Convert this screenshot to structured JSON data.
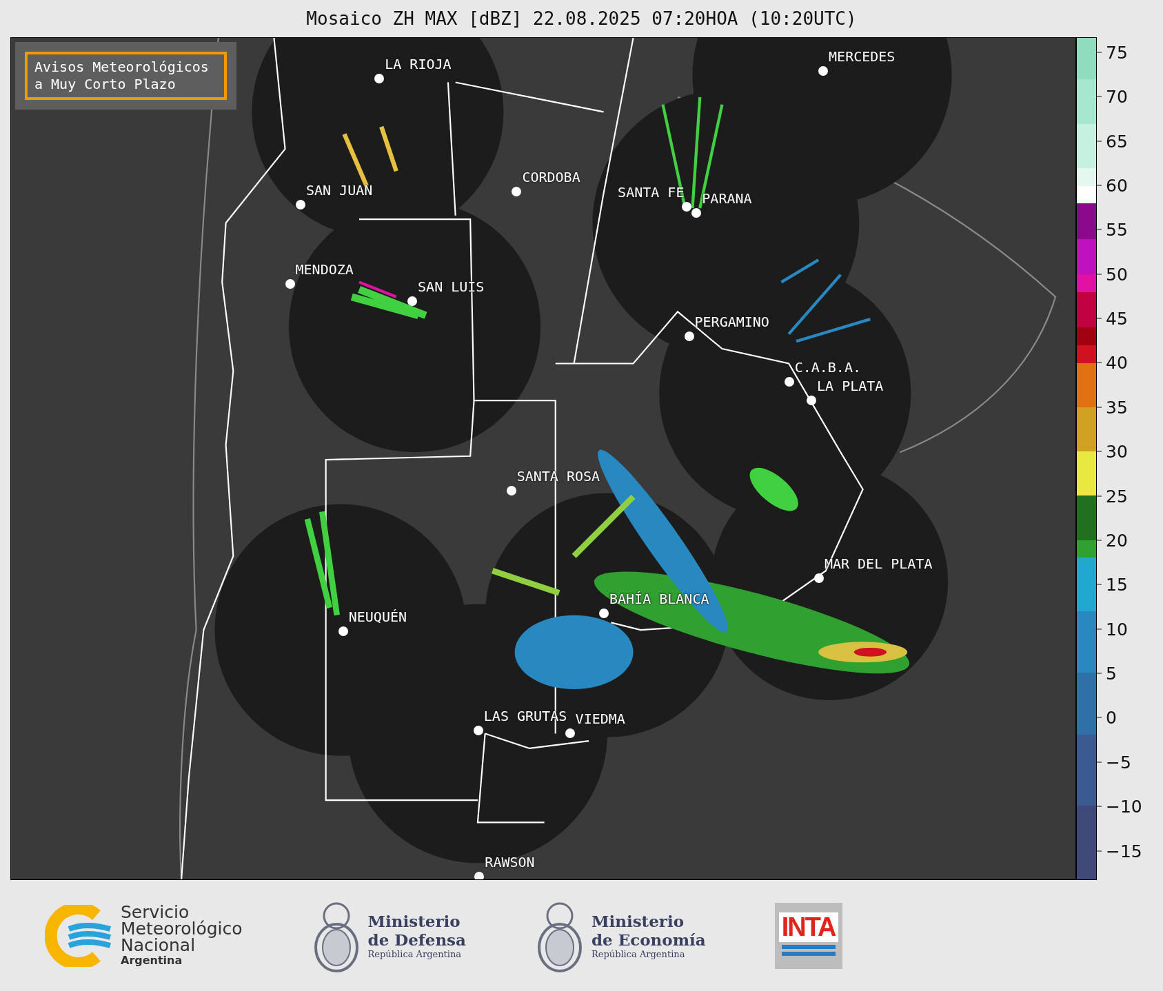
{
  "title": "Mosaico ZH MAX [dBZ] 22.08.2025 07:20HOA (10:20UTC)",
  "notice": "Avisos Meteorológicos a Muy Corto Plazo",
  "cities": [
    "LA RIOJA",
    "SAN JUAN",
    "CORDOBA",
    "SANTA FE",
    "PARANA",
    "MENDOZA",
    "SAN LUIS",
    "MERCEDES",
    "PERGAMINO",
    "C.A.B.A.",
    "LA PLATA",
    "SANTA ROSA",
    "MAR DEL PLATA",
    "BAHÍA BLANCA",
    "NEUQUÉN",
    "LAS GRUTAS",
    "VIEDMA",
    "RAWSON"
  ],
  "colorbar": {
    "ticks": [
      "75",
      "70",
      "65",
      "60",
      "55",
      "50",
      "45",
      "40",
      "35",
      "30",
      "25",
      "20",
      "15",
      "10",
      "5",
      "0",
      "−5",
      "−10",
      "−15"
    ]
  },
  "footer": {
    "smn": {
      "lines": [
        "Servicio",
        "Meteorológico",
        "Nacional"
      ],
      "country": "Argentina"
    },
    "ministries": [
      {
        "top": "Ministerio",
        "name": "de Defensa",
        "country": "República Argentina"
      },
      {
        "top": "Ministerio",
        "name": "de Economía",
        "country": "República Argentina"
      }
    ],
    "inta": "INTA"
  }
}
